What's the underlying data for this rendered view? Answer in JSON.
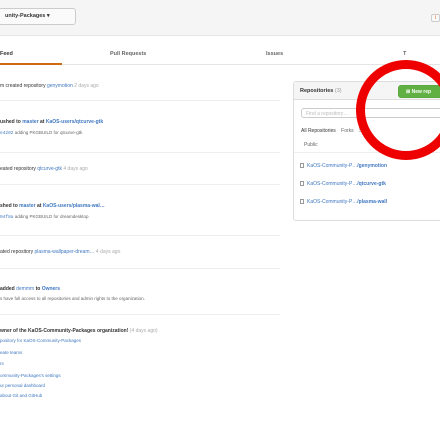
{
  "header": {
    "org_switcher": "unity-Packages ▾",
    "rss_icon": "rss-icon"
  },
  "tabs": {
    "feed": "Feed",
    "pulls": "Pull Requests",
    "issues": "Issues",
    "t4": "T"
  },
  "feed": {
    "i1": {
      "a": "m created repository ",
      "b": "genymotion",
      "c": " 2 days ago"
    },
    "i2": {
      "a": "ushed to ",
      "b": "master",
      "c": " at ",
      "d": "KaOS-users/qtcurve-gtk",
      "sha": "e4202",
      "msg": " adding PKGBUILD for qtcurve-gtk"
    },
    "i3": {
      "a": "eated repository ",
      "b": "qtcurve-gtk",
      "c": " 4 days ago"
    },
    "i4": {
      "a": "shed to ",
      "b": "master",
      "c": " at ",
      "d": "KaOS-users/plasma-wal…",
      "sha": "04f8a",
      "msg": " adding PKGBUILD for dreamdesktop"
    },
    "i5": {
      "a": "ated repository ",
      "b": "plasma-wallpaper-dream…",
      "c": " 4 days ago"
    },
    "i6": {
      "a": " added ",
      "b": "demmm",
      "c": " to ",
      "d": "Owners",
      "line2": "s have full access to all repositories and admin rights to the organization."
    },
    "i7": {
      "a": "wner of the KaOS-Community-Packages organization!",
      "c": " (4 days ago)",
      "lines": [
        "pository for KaOS-Community-Packages",
        "eate teams",
        "rs",
        "ommunity-Packages's settings",
        "ur personal dashboard",
        "about Git and GitHub"
      ]
    }
  },
  "repos": {
    "title": "Repositories",
    "count": " (3)",
    "new_btn": "New rep",
    "filter_placeholder": "Find a repository…",
    "filter_tabs": [
      "All Repositories",
      "Forks",
      "Sour"
    ],
    "public_label": "Public",
    "items": [
      {
        "owner": "KaOS-Community-P…",
        "name": "/genymotion"
      },
      {
        "owner": "KaOS-Community-P…",
        "name": "/qtcurve-gtk"
      },
      {
        "owner": "KaOS-Community-P…",
        "name": "/plasma-wall"
      }
    ]
  },
  "colors": {
    "link": "#4078c0",
    "accent": "#d26911",
    "new_button": "#60b044",
    "highlight_circle": "#ee0000"
  }
}
